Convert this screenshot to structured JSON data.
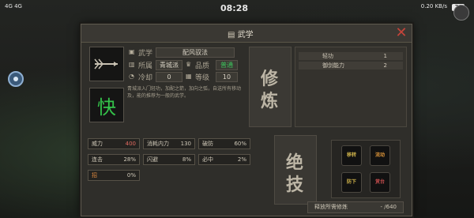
{
  "status": {
    "left_icons": "4G 4G",
    "time": "08:28",
    "right_text": "0.20\nKB/s",
    "battery": "74"
  },
  "dialog": {
    "title": "武学",
    "close": "✕",
    "icon_name": "arrow-icon",
    "speed_char": "快",
    "skill_label": "武学",
    "skill_name": "配风驭法",
    "faction_label": "所属",
    "faction_value": "青城派",
    "quality_label": "品质",
    "quality_value": "普通",
    "cooldown_label": "冷却",
    "cooldown_value": "0",
    "level_label": "等级",
    "level_value": "10",
    "description": "青城派入门轻功，加配之箭，加向之弧，自送所有移动及，能的推荐为一般的武学。",
    "xiu_title_1": "修",
    "xiu_title_2": "炼",
    "xiu_items": [
      {
        "name": "轻功",
        "level": "1"
      },
      {
        "name": "御剑能力",
        "level": "2"
      }
    ],
    "jue_title_1": "绝",
    "jue_title_2": "技",
    "stats": [
      {
        "label": "威力",
        "value": "400",
        "color": "#e0695f"
      },
      {
        "label": "消耗内力",
        "value": "130",
        "color": "#cfc8b8"
      },
      {
        "label": "破防",
        "value": "60%",
        "color": "#cfc8b8"
      },
      {
        "label": "连击",
        "value": "28%",
        "color": "#cfc8b8"
      },
      {
        "label": "闪避",
        "value": "8%",
        "color": "#cfc8b8"
      },
      {
        "label": "必中",
        "value": "2%",
        "color": "#cfc8b8"
      },
      {
        "label": "招",
        "value": "0%",
        "color": "#e08a3e"
      }
    ],
    "moves": [
      {
        "label": "移转",
        "color": "#d2b54b"
      },
      {
        "label": "流动",
        "color": "#d89238"
      },
      {
        "label": "防下",
        "color": "#d2b54b"
      },
      {
        "label": "赏台",
        "color": "#c44d4d"
      }
    ],
    "bottom_label": "释放所需修炼",
    "bottom_value": "- /640"
  }
}
